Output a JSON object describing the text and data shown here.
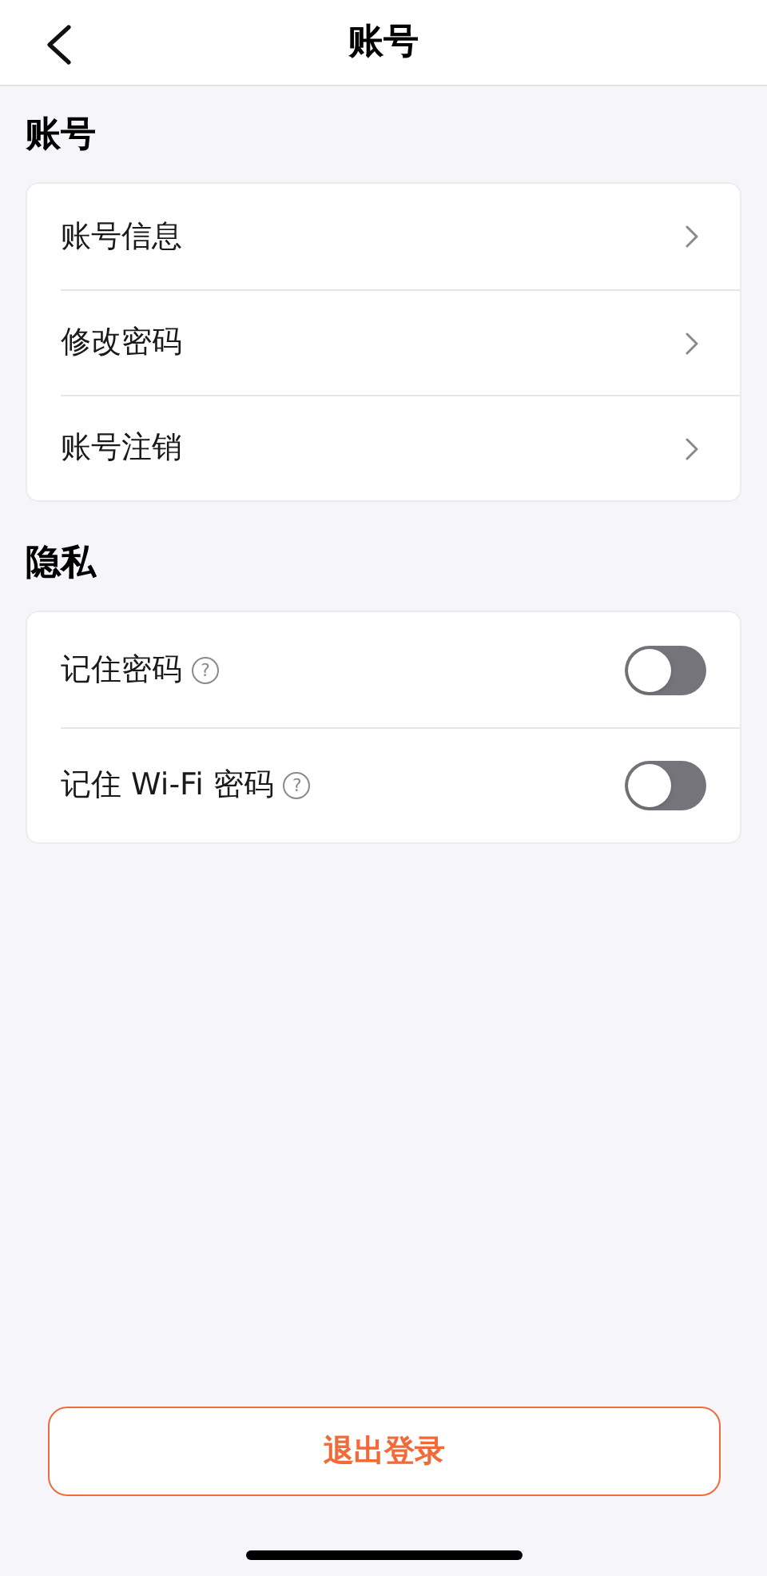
{
  "nav": {
    "title": "账号"
  },
  "sections": [
    {
      "title": "账号",
      "items": [
        {
          "kind": "link",
          "label": "账号信息"
        },
        {
          "kind": "link",
          "label": "修改密码"
        },
        {
          "kind": "link",
          "label": "账号注销"
        }
      ]
    },
    {
      "title": "隐私",
      "items": [
        {
          "kind": "toggle",
          "label": "记住密码",
          "help": "?",
          "on": false
        },
        {
          "kind": "toggle",
          "label": "记住 Wi-Fi 密码",
          "help": "?",
          "on": false
        }
      ]
    }
  ],
  "logout_button": "退出登录"
}
